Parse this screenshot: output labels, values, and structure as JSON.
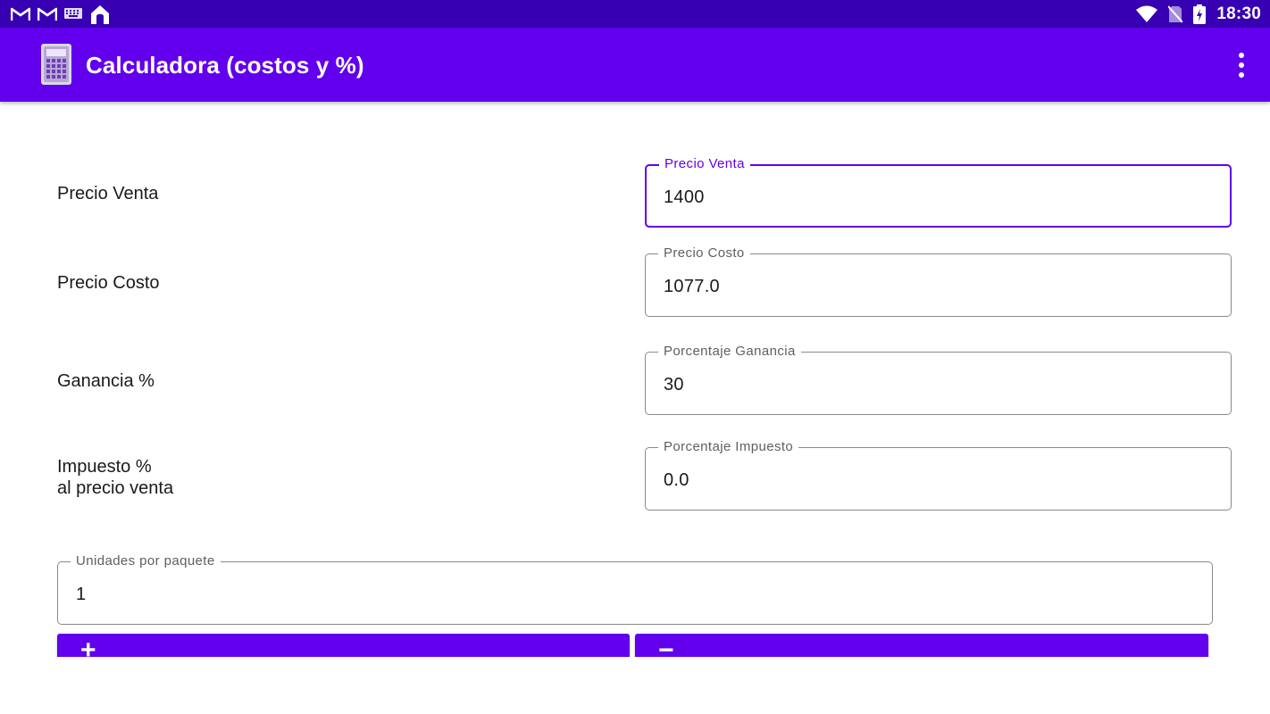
{
  "status_bar": {
    "time": "18:30",
    "left_icons": [
      "gmail-icon",
      "gmail-icon",
      "keyboard-icon",
      "home-icon"
    ],
    "right_icons": [
      "wifi-icon",
      "no-sim-icon",
      "battery-charging-icon"
    ]
  },
  "app_bar": {
    "title": "Calculadora (costos y %)",
    "icon": "calculator-icon",
    "menu_icon": "more-vert-icon"
  },
  "rows": {
    "precio_venta": {
      "label": "Precio Venta",
      "field_label": "Precio Venta",
      "value": "1400"
    },
    "precio_costo": {
      "label": "Precio Costo",
      "field_label": "Precio Costo",
      "value": "1077.0"
    },
    "ganancia": {
      "label": "Ganancia %",
      "field_label": "Porcentaje Ganancia",
      "value": "30"
    },
    "impuesto": {
      "label_line1": "Impuesto %",
      "label_line2": "al precio venta",
      "field_label": "Porcentaje Impuesto",
      "value": "0.0"
    }
  },
  "unidades": {
    "field_label": "Unidades por paquete",
    "value": "1"
  },
  "buttons": {
    "plus": "+",
    "minus": "−"
  },
  "colors": {
    "status_bar": "#3700b3",
    "app_bar": "#6200ee",
    "accent": "#6200ee"
  }
}
